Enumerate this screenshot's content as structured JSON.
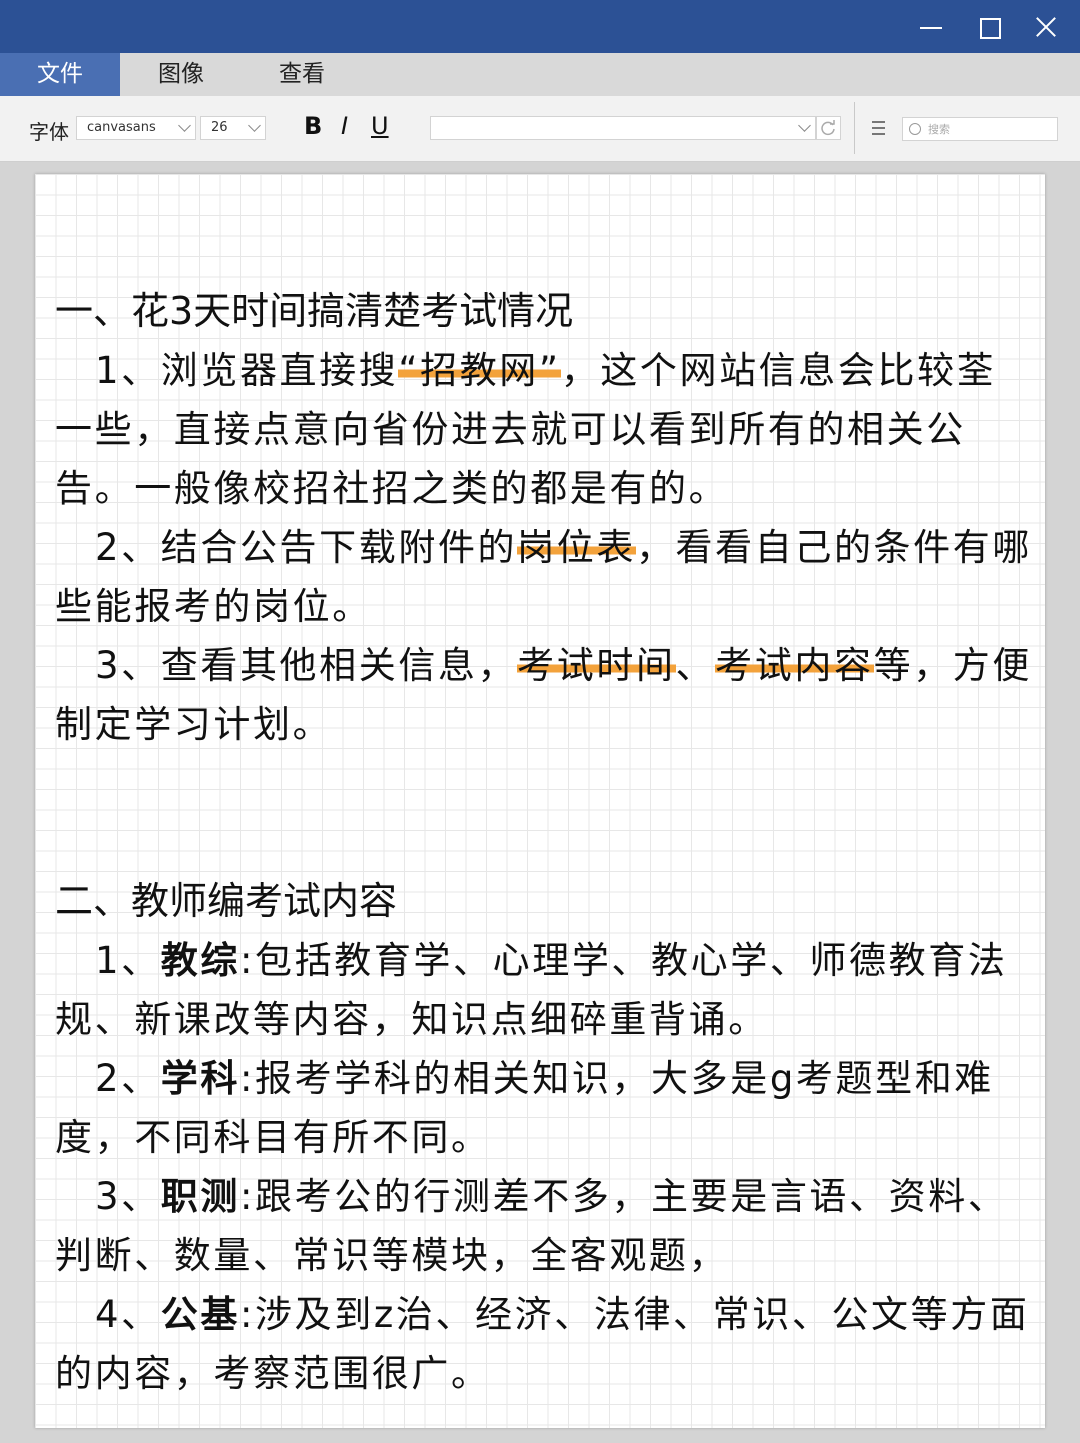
{
  "window": {
    "minimize_icon": "minimize-icon",
    "maximize_icon": "maximize-icon",
    "close_icon": "close-icon"
  },
  "menu": {
    "tabs": [
      "文件",
      "图像",
      "查看"
    ],
    "active_tab": "文件"
  },
  "toolbar": {
    "font_label": "字体",
    "font_family": "canvasans",
    "font_size": "26",
    "bold": "B",
    "italic": "I",
    "underline": "U",
    "search_placeholder": "搜索"
  },
  "colors": {
    "titlebar": "#2c5195",
    "active_tab": "#4a6fb3",
    "highlight": "#f3a23b"
  },
  "document": {
    "section1": {
      "heading": "一、花3天时间搞清楚考试情况",
      "item1": {
        "pre": "1、浏览器直接搜",
        "hl": "“招教网”",
        "post": "，这个网站信息会比较荃一些，直接点意向省份进去就可以看到所有的相关公告。一般像校招社招之类的都是有的。"
      },
      "item2": {
        "pre": "2、结合公告下载附件的",
        "hl": "岗位表",
        "post": "，看看自己的条件有哪些能报考的岗位。"
      },
      "item3": {
        "pre": "3、查看其他相关信息，",
        "hl1": "考试时间",
        "mid": "、",
        "hl2": "考试内容",
        "post": "等，方便制定学习计划。"
      }
    },
    "section2": {
      "heading": "二、教师编考试内容",
      "item1": {
        "num": "1、",
        "term": "教综",
        "text": ":包括教育学、心理学、教心学、师德教育法规、新课改等内容，知识点细碎重背诵。"
      },
      "item2": {
        "num": "2、",
        "term": "学科",
        "text": ":报考学科的相关知识，大多是g考题型和难度，不同科目有所不同。"
      },
      "item3": {
        "num": "3、",
        "term": "职测",
        "text": ":跟考公的行测差不多，主要是言语、资料、判断、数量、常识等模块，全客观题，"
      },
      "item4": {
        "num": "4、",
        "term": "公基",
        "text": ":涉及到z治、经济、法律、常识、公文等方面的内容，考察范围很广。"
      }
    }
  }
}
